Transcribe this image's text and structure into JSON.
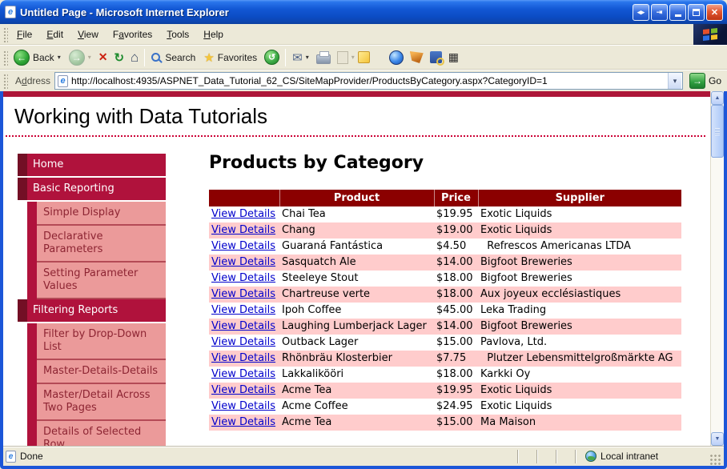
{
  "window": {
    "title": "Untitled Page - Microsoft Internet Explorer",
    "menus": [
      {
        "label": "File",
        "underline": 0
      },
      {
        "label": "Edit",
        "underline": 0
      },
      {
        "label": "View",
        "underline": 0
      },
      {
        "label": "Favorites",
        "underline": 1
      },
      {
        "label": "Tools",
        "underline": 0
      },
      {
        "label": "Help",
        "underline": 0
      }
    ]
  },
  "toolbar": {
    "back_label": "Back",
    "search_label": "Search",
    "favorites_label": "Favorites"
  },
  "address_bar": {
    "label": "Address",
    "underline": 1,
    "url": "http://localhost:4935/ASPNET_Data_Tutorial_62_CS/SiteMapProvider/ProductsByCategory.aspx?CategoryID=1",
    "go_label": "Go"
  },
  "page": {
    "site_title": "Working with Data Tutorials",
    "heading": "Products by Category",
    "sidebar": [
      {
        "label": "Home",
        "level": 1
      },
      {
        "label": "Basic Reporting",
        "level": 1
      },
      {
        "label": "Simple Display",
        "level": 2
      },
      {
        "label": "Declarative Parameters",
        "level": 2
      },
      {
        "label": "Setting Parameter Values",
        "level": 2
      },
      {
        "label": "Filtering Reports",
        "level": 1
      },
      {
        "label": "Filter by Drop-Down List",
        "level": 2
      },
      {
        "label": "Master-Details-Details",
        "level": 2
      },
      {
        "label": "Master/Detail Across Two Pages",
        "level": 2
      },
      {
        "label": "Details of Selected Row",
        "level": 2
      }
    ],
    "table": {
      "link_label": "View Details",
      "columns": [
        "",
        "Product",
        "Price",
        "Supplier"
      ],
      "rows": [
        {
          "product": "Chai Tea",
          "price": "$19.95",
          "supplier": "Exotic Liquids"
        },
        {
          "product": "Chang",
          "price": "$19.00",
          "supplier": "Exotic Liquids"
        },
        {
          "product": "Guaraná Fantástica",
          "price": "$4.50",
          "supplier": "  Refrescos Americanas LTDA"
        },
        {
          "product": "Sasquatch Ale",
          "price": "$14.00",
          "supplier": "Bigfoot Breweries"
        },
        {
          "product": "Steeleye Stout",
          "price": "$18.00",
          "supplier": "Bigfoot Breweries"
        },
        {
          "product": "Chartreuse verte",
          "price": "$18.00",
          "supplier": "Aux joyeux ecclésiastiques"
        },
        {
          "product": "Ipoh Coffee",
          "price": "$45.00",
          "supplier": "Leka Trading"
        },
        {
          "product": "Laughing Lumberjack Lager",
          "price": "$14.00",
          "supplier": "Bigfoot Breweries"
        },
        {
          "product": "Outback Lager",
          "price": "$15.00",
          "supplier": "Pavlova, Ltd."
        },
        {
          "product": "Rhönbräu Klosterbier",
          "price": "$7.75",
          "supplier": "  Plutzer Lebensmittelgroßmärkte AG"
        },
        {
          "product": "Lakkalikööri",
          "price": "$18.00",
          "supplier": "Karkki Oy"
        },
        {
          "product": "Acme Tea",
          "price": "$19.95",
          "supplier": "Exotic Liquids"
        },
        {
          "product": "Acme Coffee",
          "price": "$24.95",
          "supplier": "Exotic Liquids"
        },
        {
          "product": "Acme Tea",
          "price": "$15.00",
          "supplier": "Ma Maison"
        }
      ]
    }
  },
  "status_bar": {
    "left": "Done",
    "right": "Local intranet"
  },
  "icons": {
    "back_arrow": "←",
    "forward_arrow": "→",
    "stop": "✕",
    "refresh": "↻",
    "home": "⌂",
    "favorites_star": "★",
    "history": "↺",
    "mail": "✉",
    "caret_down": "▾",
    "scroll_up": "▲",
    "scroll_down": "▼",
    "go_arrow": "→",
    "close": "✕",
    "title_extra_arrows": "◂▸",
    "title_extra_popout": "⇥",
    "matrix": "▦",
    "ie_logo": "e"
  },
  "colors": {
    "frame_blue": "#1c56d8",
    "strip_red": "#ad1638",
    "dotted_red": "#cc0236",
    "menu_crimson": "#b0123c",
    "dark_maroon": "#730f25",
    "submenu_salmon": "#eb9a9a",
    "submenu_text": "#8d2533",
    "table_header": "#8b0000",
    "row_pink": "#ffcccc",
    "link_blue": "#0000cc"
  }
}
